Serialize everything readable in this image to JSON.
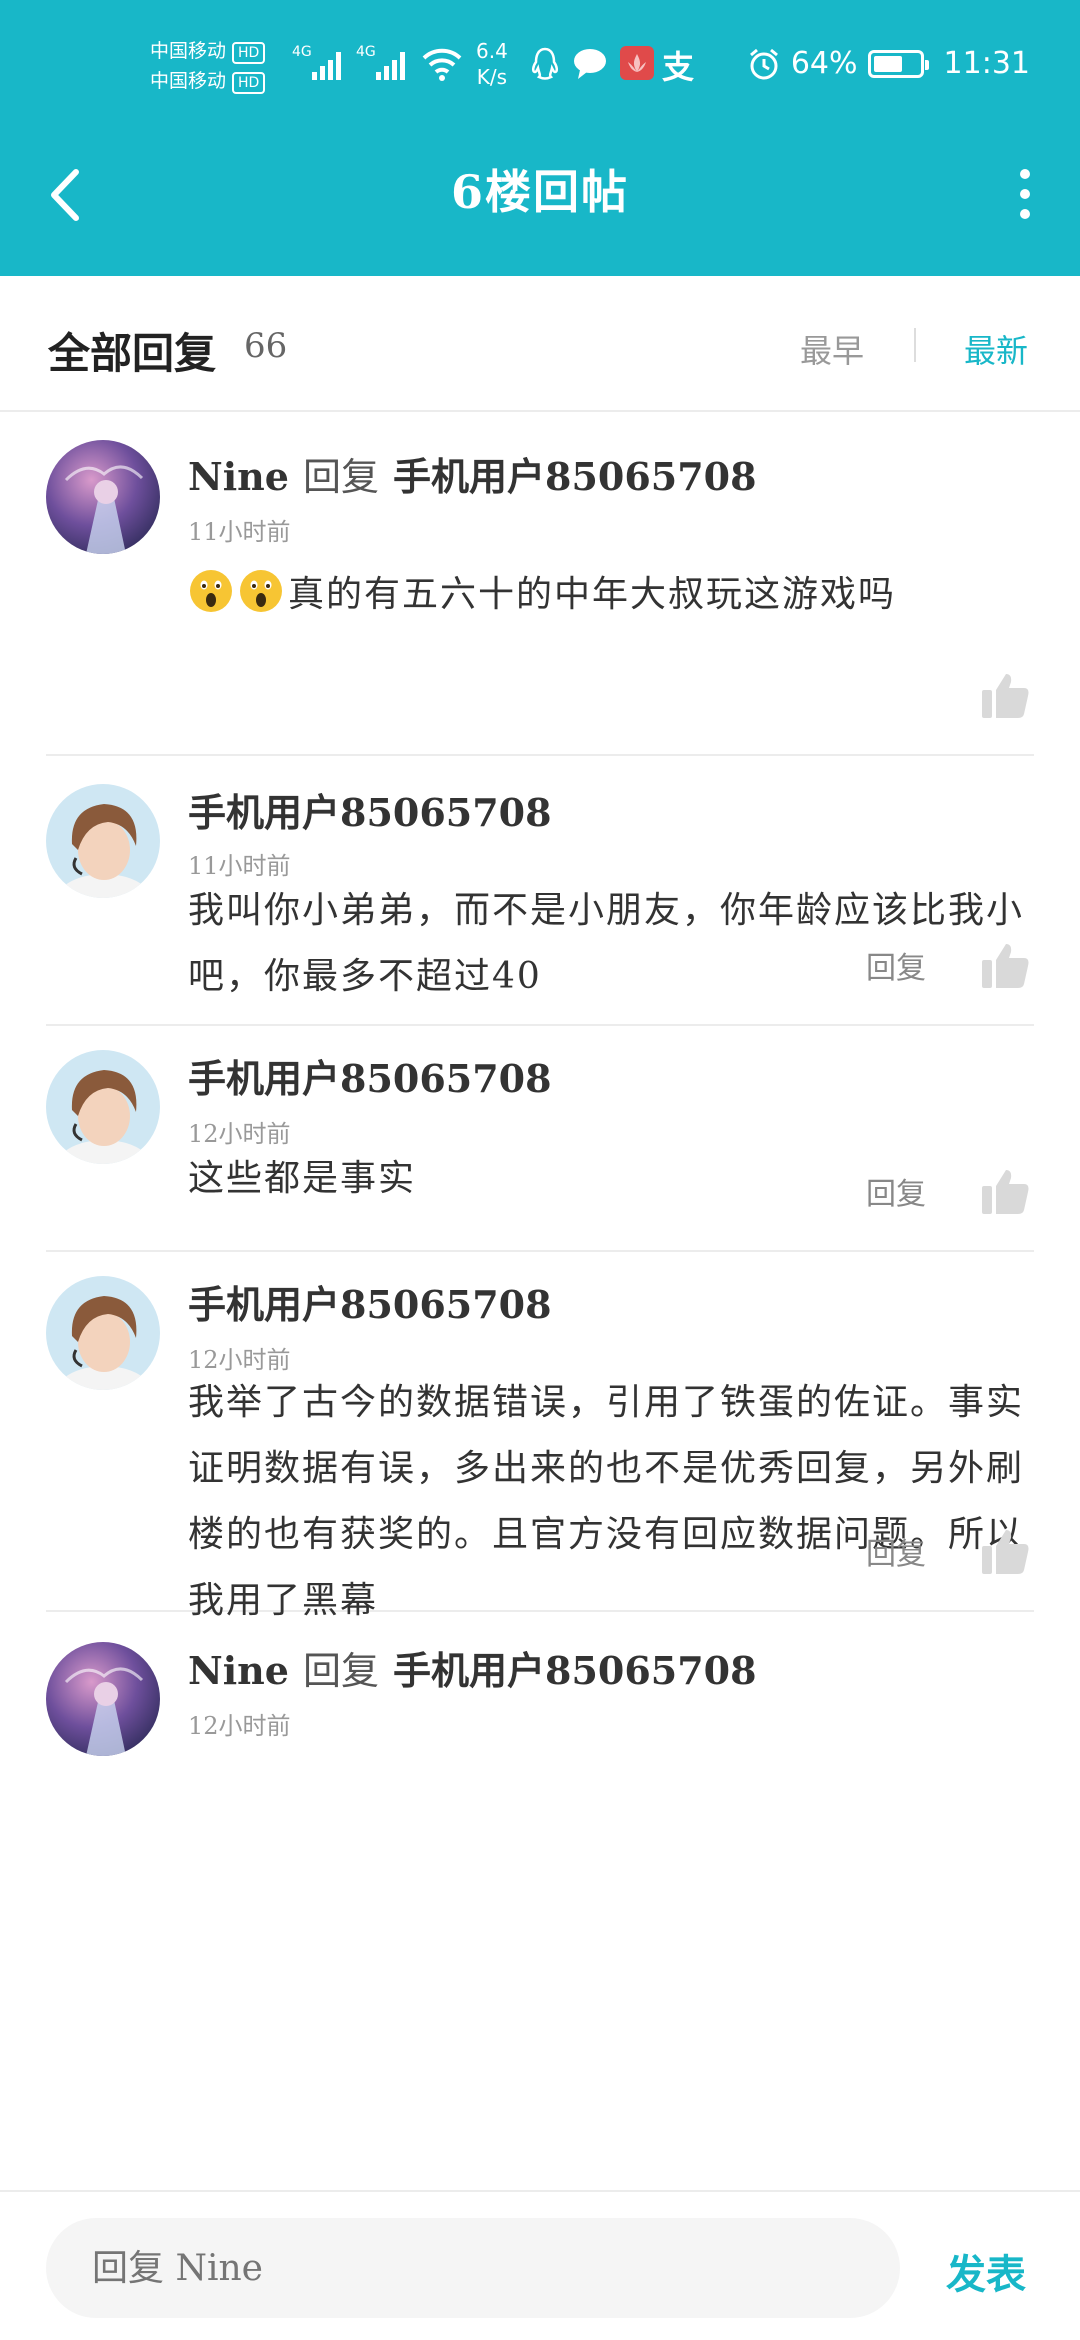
{
  "status_bar": {
    "carrier_1": "中国移动",
    "carrier_2": "中国移动",
    "hd_badge": "HD",
    "network_1": "4G",
    "network_2": "4G",
    "speed_value": "6.4",
    "speed_unit": "K/s",
    "notification_icons": [
      "qq-icon",
      "chat-bubble-icon",
      "app-icon",
      "alipay-icon"
    ],
    "alipay_glyph": "支",
    "alarm_icon": "alarm-icon",
    "battery_percent": "64%",
    "battery_level": 0.64,
    "time": "11:31"
  },
  "nav": {
    "title": "6楼回帖",
    "back_icon": "chevron-left-icon",
    "more_icon": "more-vertical-icon"
  },
  "filter": {
    "title": "全部回复",
    "count": "66",
    "sort_earliest": "最早",
    "sort_newest": "最新",
    "active_sort": "newest"
  },
  "replies": [
    {
      "author": "Nine",
      "reply_word": "回复",
      "target": "手机用户85065708",
      "time": "11小时前",
      "emoji_prefix": [
        "astonished-face-icon",
        "astonished-face-icon"
      ],
      "content": "真的有五六十的中年大叔玩这游戏吗",
      "show_reply": false
    },
    {
      "author": "手机用户85065708",
      "time": "11小时前",
      "content": "我叫你小弟弟，而不是小朋友，你年龄应该比我小吧，你最多不超过40",
      "reply_label": "回复",
      "show_reply": true
    },
    {
      "author": "手机用户85065708",
      "time": "12小时前",
      "content": "这些都是事实",
      "reply_label": "回复",
      "show_reply": true
    },
    {
      "author": "手机用户85065708",
      "time": "12小时前",
      "content": "我举了古今的数据错误，引用了铁蛋的佐证。事实证明数据有误，多出来的也不是优秀回复，另外刷楼的也有获奖的。且官方没有回应数据问题。所以我用了黑幕",
      "reply_label": "回复",
      "show_reply": true
    },
    {
      "author": "Nine",
      "reply_word": "回复",
      "target": "手机用户85065708",
      "time": "12小时前",
      "content": "",
      "show_reply": false
    }
  ],
  "composer": {
    "placeholder": "回复 Nine",
    "send_label": "发表"
  },
  "colors": {
    "accent": "#18b7c8",
    "divider": "#ececec",
    "muted": "#999999"
  }
}
